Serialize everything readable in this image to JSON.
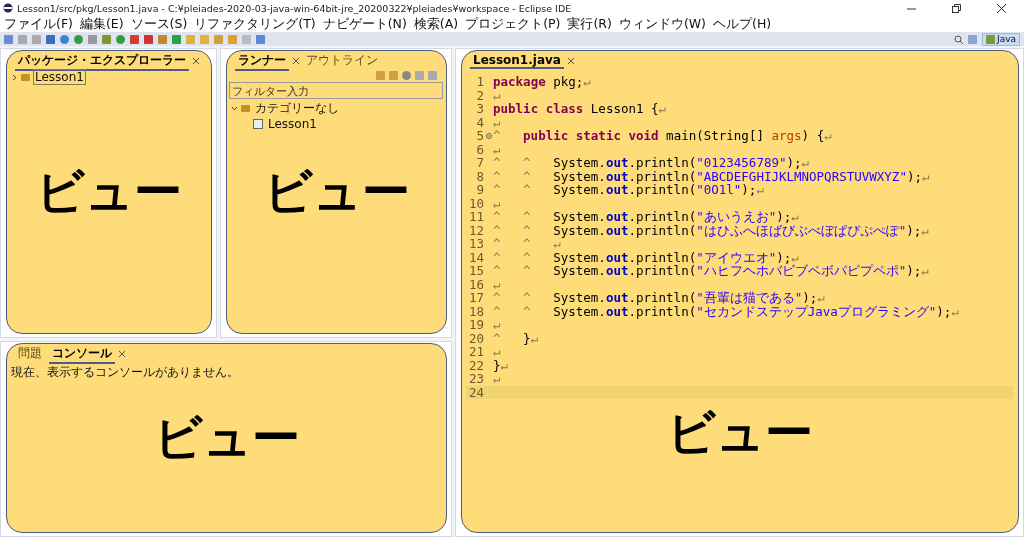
{
  "window": {
    "title": "Lesson1/src/pkg/Lesson1.java - C:¥pleiades-2020-03-java-win-64bit-jre_20200322¥pleiades¥workspace - Eclipse IDE"
  },
  "menu": [
    "ファイル(F)",
    "編集(E)",
    "ソース(S)",
    "リファクタリング(T)",
    "ナビゲート(N)",
    "検索(A)",
    "プロジェクト(P)",
    "実行(R)",
    "ウィンドウ(W)",
    "ヘルプ(H)"
  ],
  "perspective": {
    "label": "Java",
    "selected": true
  },
  "package_explorer": {
    "tab": {
      "label": "パッケージ・エクスプローラー",
      "selected": true
    },
    "tree": [
      {
        "label": "Lesson1",
        "expanded": false,
        "selected": true
      }
    ],
    "callout": "ビュー"
  },
  "runner": {
    "tabs": [
      {
        "label": "ランナー",
        "selected": true
      },
      {
        "label": "アウトライン",
        "selected": false
      }
    ],
    "filter": {
      "placeholder": "フィルター入力"
    },
    "tree": [
      {
        "label": "カテゴリーなし",
        "expanded": true,
        "selected": false,
        "children": [
          {
            "label": "Lesson1",
            "selected": false
          }
        ]
      }
    ],
    "callout": "ビュー"
  },
  "console": {
    "tabs": [
      {
        "label": "問題",
        "selected": false
      },
      {
        "label": "コンソール",
        "selected": true
      }
    ],
    "message": "現在、表示するコンソールがありません。",
    "callout": "ビュー"
  },
  "editor": {
    "tab": {
      "label": "Lesson1.java",
      "selected": true
    },
    "callout": "ビュー",
    "lines": [
      {
        "number": "1",
        "tokens": [
          {
            "kind": "kw",
            "t": "package"
          },
          {
            "kind": "plain",
            "t": " pkg;"
          },
          {
            "kind": "eol",
            "t": "↵"
          }
        ]
      },
      {
        "number": "2",
        "tokens": [
          {
            "kind": "eol",
            "t": "↵"
          }
        ]
      },
      {
        "number": "3",
        "tokens": [
          {
            "kind": "kw",
            "t": "public"
          },
          {
            "kind": "kw",
            "t": " class"
          },
          {
            "kind": "plain",
            "t": " Lesson1 {"
          },
          {
            "kind": "eol",
            "t": "↵"
          }
        ]
      },
      {
        "number": "4",
        "tokens": [
          {
            "kind": "eol",
            "t": "↵"
          }
        ]
      },
      {
        "number": "5",
        "fold": true,
        "tokens": [
          {
            "kind": "tab",
            "t": "^"
          },
          {
            "kind": "kw",
            "t": "public"
          },
          {
            "kind": "kw",
            "t": " static"
          },
          {
            "kind": "kw",
            "t": " void"
          },
          {
            "kind": "plain",
            "t": " main(String[] "
          },
          {
            "kind": "param",
            "t": "args"
          },
          {
            "kind": "plain",
            "t": ") {"
          },
          {
            "kind": "eol",
            "t": "↵"
          }
        ]
      },
      {
        "number": "6",
        "tokens": [
          {
            "kind": "eol",
            "t": "↵"
          }
        ]
      },
      {
        "number": "7",
        "tokens": [
          {
            "kind": "tab",
            "t": "^"
          },
          {
            "kind": "tab",
            "t": "^"
          },
          {
            "kind": "plain",
            "t": "System."
          },
          {
            "kind": "field",
            "t": "out"
          },
          {
            "kind": "plain",
            "t": ".println("
          },
          {
            "kind": "str",
            "t": "\"0123456789\""
          },
          {
            "kind": "plain",
            "t": ");"
          },
          {
            "kind": "eol",
            "t": "↵"
          }
        ]
      },
      {
        "number": "8",
        "tokens": [
          {
            "kind": "tab",
            "t": "^"
          },
          {
            "kind": "tab",
            "t": "^"
          },
          {
            "kind": "plain",
            "t": "System."
          },
          {
            "kind": "field",
            "t": "out"
          },
          {
            "kind": "plain",
            "t": ".println("
          },
          {
            "kind": "str",
            "t": "\"ABCDEFGHIJKLMNOPQRSTUVWXYZ\""
          },
          {
            "kind": "plain",
            "t": ");"
          },
          {
            "kind": "eol",
            "t": "↵"
          }
        ]
      },
      {
        "number": "9",
        "tokens": [
          {
            "kind": "tab",
            "t": "^"
          },
          {
            "kind": "tab",
            "t": "^"
          },
          {
            "kind": "plain",
            "t": "System."
          },
          {
            "kind": "field",
            "t": "out"
          },
          {
            "kind": "plain",
            "t": ".println("
          },
          {
            "kind": "str",
            "t": "\"0O1l\""
          },
          {
            "kind": "plain",
            "t": ");"
          },
          {
            "kind": "eol",
            "t": "↵"
          }
        ]
      },
      {
        "number": "10",
        "tokens": [
          {
            "kind": "eol",
            "t": "↵"
          }
        ]
      },
      {
        "number": "11",
        "tokens": [
          {
            "kind": "tab",
            "t": "^"
          },
          {
            "kind": "tab",
            "t": "^"
          },
          {
            "kind": "plain",
            "t": "System."
          },
          {
            "kind": "field",
            "t": "out"
          },
          {
            "kind": "plain",
            "t": ".println("
          },
          {
            "kind": "str",
            "t": "\"あいうえお\""
          },
          {
            "kind": "plain",
            "t": ");"
          },
          {
            "kind": "eol",
            "t": "↵"
          }
        ]
      },
      {
        "number": "12",
        "tokens": [
          {
            "kind": "tab",
            "t": "^"
          },
          {
            "kind": "tab",
            "t": "^"
          },
          {
            "kind": "plain",
            "t": "System."
          },
          {
            "kind": "field",
            "t": "out"
          },
          {
            "kind": "plain",
            "t": ".println("
          },
          {
            "kind": "str",
            "t": "\"はひふへほばびぶべぼぱぴぷぺぽ\""
          },
          {
            "kind": "plain",
            "t": ");"
          },
          {
            "kind": "eol",
            "t": "↵"
          }
        ]
      },
      {
        "number": "13",
        "tokens": [
          {
            "kind": "tab",
            "t": "^"
          },
          {
            "kind": "tab",
            "t": "^"
          },
          {
            "kind": "eol",
            "t": "↵"
          }
        ]
      },
      {
        "number": "14",
        "tokens": [
          {
            "kind": "tab",
            "t": "^"
          },
          {
            "kind": "tab",
            "t": "^"
          },
          {
            "kind": "plain",
            "t": "System."
          },
          {
            "kind": "field",
            "t": "out"
          },
          {
            "kind": "plain",
            "t": ".println("
          },
          {
            "kind": "str",
            "t": "\"アイウエオ\""
          },
          {
            "kind": "plain",
            "t": ");"
          },
          {
            "kind": "eol",
            "t": "↵"
          }
        ]
      },
      {
        "number": "15",
        "tokens": [
          {
            "kind": "tab",
            "t": "^"
          },
          {
            "kind": "tab",
            "t": "^"
          },
          {
            "kind": "plain",
            "t": "System."
          },
          {
            "kind": "field",
            "t": "out"
          },
          {
            "kind": "plain",
            "t": ".println("
          },
          {
            "kind": "str",
            "t": "\"ハヒフヘホバビブベボパピプペポ\""
          },
          {
            "kind": "plain",
            "t": ");"
          },
          {
            "kind": "eol",
            "t": "↵"
          }
        ]
      },
      {
        "number": "16",
        "tokens": [
          {
            "kind": "eol",
            "t": "↵"
          }
        ]
      },
      {
        "number": "17",
        "tokens": [
          {
            "kind": "tab",
            "t": "^"
          },
          {
            "kind": "tab",
            "t": "^"
          },
          {
            "kind": "plain",
            "t": "System."
          },
          {
            "kind": "field",
            "t": "out"
          },
          {
            "kind": "plain",
            "t": ".println("
          },
          {
            "kind": "str",
            "t": "\"吾輩は猫である\""
          },
          {
            "kind": "plain",
            "t": ");"
          },
          {
            "kind": "eol",
            "t": "↵"
          }
        ]
      },
      {
        "number": "18",
        "tokens": [
          {
            "kind": "tab",
            "t": "^"
          },
          {
            "kind": "tab",
            "t": "^"
          },
          {
            "kind": "plain",
            "t": "System."
          },
          {
            "kind": "field",
            "t": "out"
          },
          {
            "kind": "plain",
            "t": ".println("
          },
          {
            "kind": "str",
            "t": "\"セカンドステップJavaプログラミング\""
          },
          {
            "kind": "plain",
            "t": ");"
          },
          {
            "kind": "eol",
            "t": "↵"
          }
        ]
      },
      {
        "number": "19",
        "tokens": [
          {
            "kind": "eol",
            "t": "↵"
          }
        ]
      },
      {
        "number": "20",
        "tokens": [
          {
            "kind": "tab",
            "t": "^"
          },
          {
            "kind": "plain",
            "t": "}"
          },
          {
            "kind": "eol",
            "t": "↵"
          }
        ]
      },
      {
        "number": "21",
        "tokens": [
          {
            "kind": "eol",
            "t": "↵"
          }
        ]
      },
      {
        "number": "22",
        "tokens": [
          {
            "kind": "plain",
            "t": "}"
          },
          {
            "kind": "eol",
            "t": "↵"
          }
        ]
      },
      {
        "number": "23",
        "tokens": [
          {
            "kind": "eol",
            "t": "↵"
          }
        ]
      },
      {
        "number": "24",
        "current": true
      }
    ]
  }
}
